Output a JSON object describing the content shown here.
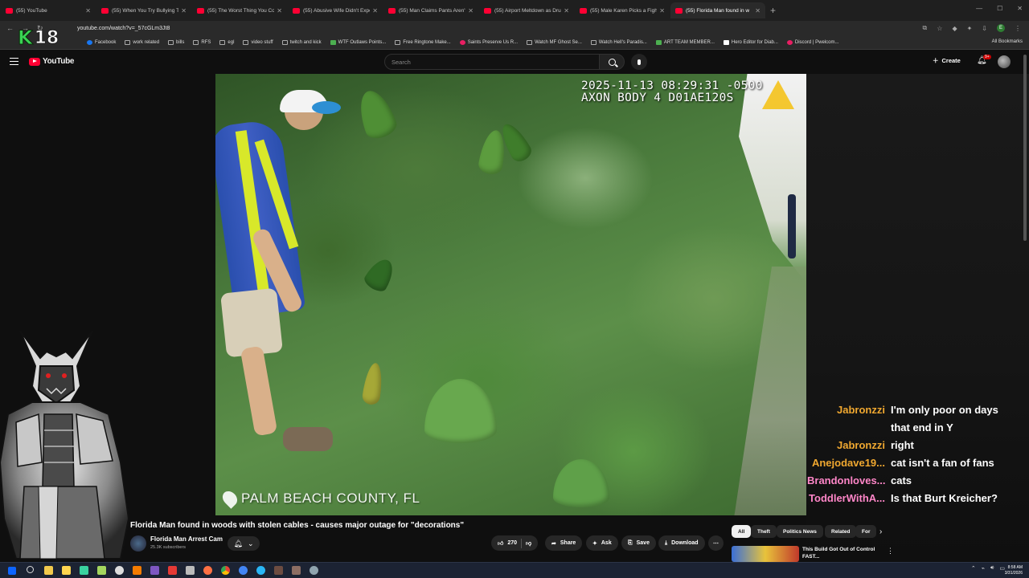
{
  "browser": {
    "tabs": [
      {
        "title": "(55) YouTube",
        "active": false
      },
      {
        "title": "(55) When You Try Bullying The",
        "active": false
      },
      {
        "title": "(55) The Worst Thing You Could",
        "active": false
      },
      {
        "title": "(55) Abusive Wife Didn't Expect",
        "active": false
      },
      {
        "title": "(55) Man Claims Pants Aren't H",
        "active": false
      },
      {
        "title": "(55) Airport Meltdown as Drun",
        "active": false
      },
      {
        "title": "(55) Male Karen Picks a Fight W",
        "active": false
      },
      {
        "title": "(55) Florida Man found in w",
        "active": true
      }
    ],
    "new_tab": "+",
    "url": "youtube.com/watch?v=_57cGLm3Jt8",
    "profile_initial": "E",
    "bookmarks": [
      {
        "label": "Facebook",
        "icon": "fb"
      },
      {
        "label": "work related",
        "icon": "folder"
      },
      {
        "label": "bills",
        "icon": "folder"
      },
      {
        "label": "RFS",
        "icon": "folder"
      },
      {
        "label": "egl",
        "icon": "folder"
      },
      {
        "label": "video stuff",
        "icon": "folder"
      },
      {
        "label": "twitch and kick",
        "icon": "folder"
      },
      {
        "label": "WTF Outlaws Points...",
        "icon": "g"
      },
      {
        "label": "Free Ringtone Make...",
        "icon": "folder"
      },
      {
        "label": "Saints Preserve Us R...",
        "icon": "p"
      },
      {
        "label": "Watch MF Ghost Se...",
        "icon": "folder"
      },
      {
        "label": "Watch Hell's Paradis...",
        "icon": "folder"
      },
      {
        "label": "ART TEAM MEMBER...",
        "icon": "g"
      },
      {
        "label": "Hero Editor for Diab...",
        "icon": "w"
      },
      {
        "label": "Discord | Pwelcom...",
        "icon": "p"
      }
    ],
    "all_bookmarks": "All Bookmarks"
  },
  "overlay_logo": {
    "letter": "K",
    "number": "18"
  },
  "youtube": {
    "logo_text": "YouTube",
    "search_placeholder": "Search",
    "create_label": "Create",
    "notif_badge": "9+"
  },
  "video": {
    "bodycam_line1": "2025-11-13 08:29:31 -0500",
    "bodycam_line2": "AXON BODY 4 D01AE120S",
    "location": "PALM BEACH COUNTY, FL",
    "title": "Florida Man found in woods with stolen cables - causes major outage for \"decorations\"",
    "channel_name": "Florida Man Arrest Cam",
    "subscribers": "25.3K subscribers",
    "likes": "270",
    "share_label": "Share",
    "ask_label": "Ask",
    "save_label": "Save",
    "download_label": "Download"
  },
  "chat": [
    {
      "user": "Jabronzzi",
      "message": "I'm only poor on days",
      "color": "#f0a830"
    },
    {
      "user": "",
      "message": "that end in Y",
      "color": "#f0a830"
    },
    {
      "user": "Jabronzzi",
      "message": "right",
      "color": "#f0a830"
    },
    {
      "user": "Anejodave19...",
      "message": "cat isn't a fan of fans",
      "color": "#f0a830"
    },
    {
      "user": "Brandonloves...",
      "message": "cats",
      "color": "#ff86c8"
    },
    {
      "user": "ToddlerWithA...",
      "message": "Is that Burt Kreicher?",
      "color": "#ff86c8"
    }
  ],
  "chips": [
    "All",
    "Theft",
    "Politics News",
    "Related",
    "For"
  ],
  "recommendation": {
    "title": "This Build Got Out of Control FAST..."
  },
  "taskbar": {
    "time": "8:58 AM",
    "date": "3/31/2026"
  }
}
